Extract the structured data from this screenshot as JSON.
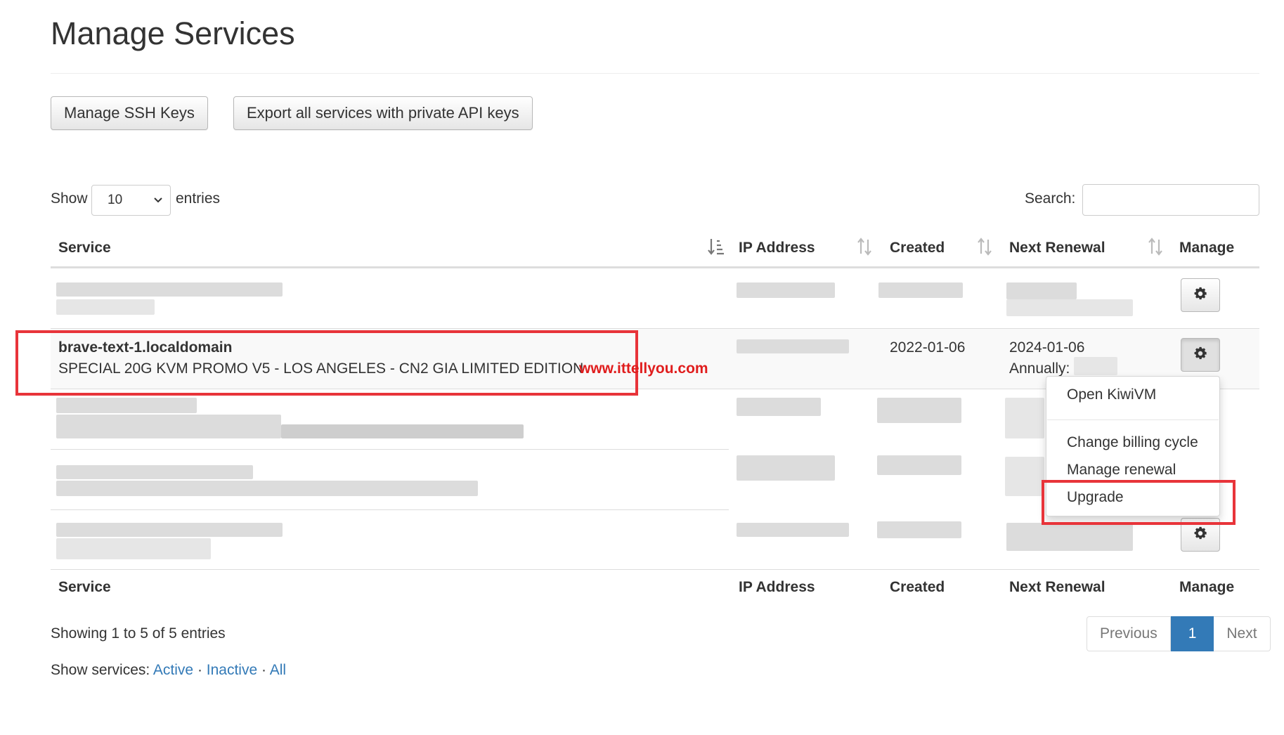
{
  "page": {
    "title": "Manage Services"
  },
  "toolbar": {
    "ssh_keys_label": "Manage SSH Keys",
    "export_label": "Export all services with private API keys"
  },
  "table_controls": {
    "show_label": "Show",
    "entries_label": "entries",
    "page_size": "10",
    "search_label": "Search:",
    "search_value": ""
  },
  "columns": [
    "Service",
    "IP Address",
    "Created",
    "Next Renewal",
    "Manage"
  ],
  "rows": [
    {
      "hostname": "",
      "plan": "",
      "ip": "",
      "created": "",
      "renewal": "",
      "cycle": ""
    },
    {
      "hostname": "brave-text-1.localdomain",
      "plan": "SPECIAL 20G KVM PROMO V5 - LOS ANGELES - CN2 GIA LIMITED EDITION",
      "ip": "",
      "created": "2022-01-06",
      "renewal": "2024-01-06",
      "cycle": "Annually:"
    },
    {
      "hostname": "",
      "plan": "",
      "ip": "",
      "created": "",
      "renewal": "",
      "cycle": ""
    },
    {
      "hostname": "",
      "plan": "",
      "ip": "",
      "created": "",
      "renewal": "",
      "cycle": ""
    },
    {
      "hostname": "",
      "plan": "",
      "ip": "",
      "created": "",
      "renewal": "",
      "cycle": ""
    }
  ],
  "manage_menu": {
    "items": [
      "Open KiwiVM",
      "Change billing cycle",
      "Manage renewal",
      "Upgrade"
    ]
  },
  "watermark": "www.ittellyou.com",
  "table_info": "Showing 1 to 5 of 5 entries",
  "pagination": {
    "previous": "Previous",
    "current": "1",
    "next": "Next"
  },
  "service_filter": {
    "label": "Show services:",
    "links": [
      "Active",
      "Inactive",
      "All"
    ],
    "separator": "·"
  },
  "colors": {
    "highlight_red": "#e8343a",
    "link_blue": "#337ab7",
    "watermark_red": "#e01d1d"
  },
  "icons": {
    "manage_button": "gear-icon",
    "sort": "sort-arrows-icon"
  }
}
